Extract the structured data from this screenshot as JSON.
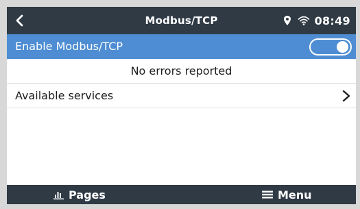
{
  "header": {
    "title": "Modbus/TCP",
    "time": "08:49",
    "back_icon": "chevron-left-icon",
    "status_icons": [
      "location-pin-icon",
      "wifi-icon"
    ]
  },
  "settings": {
    "enable_label": "Enable Modbus/TCP",
    "enable_on": true,
    "status_text": "No errors reported",
    "services_label": "Available services"
  },
  "footer": {
    "pages_label": "Pages",
    "menu_label": "Menu",
    "pages_icon": "bar-chart-icon",
    "menu_icon": "hamburger-icon"
  },
  "colors": {
    "bar_background": "#2f3a45",
    "selected_row": "#4e8dd3",
    "bezel": "#d8d8d8"
  }
}
